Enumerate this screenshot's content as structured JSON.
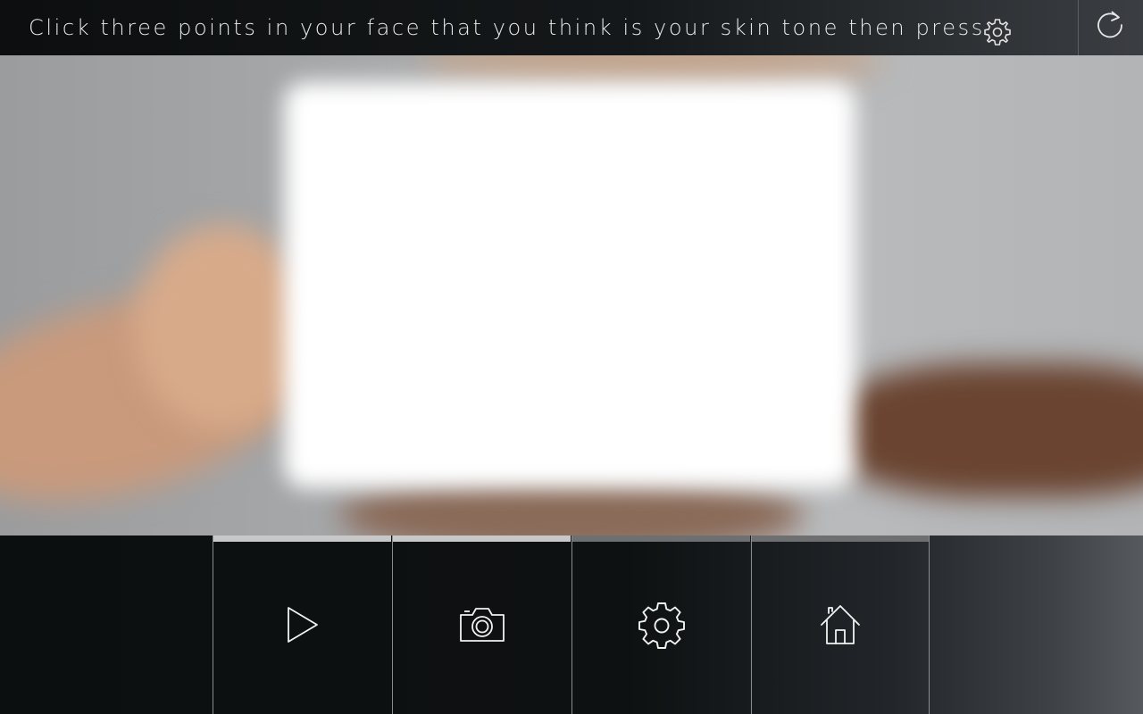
{
  "header": {
    "instruction": "Click three points in your face that you think is your skin tone then press",
    "inline_icon": "gear-icon",
    "refresh_icon": "refresh-icon"
  },
  "preview": {
    "description_icon": "camera-preview"
  },
  "toolbar": {
    "buttons": [
      {
        "icon": "play-icon",
        "strip_color": "#c8c8c8"
      },
      {
        "icon": "camera-icon",
        "strip_color": "#c8c8c8"
      },
      {
        "icon": "gear-icon",
        "strip_color": "#6e6f70"
      },
      {
        "icon": "home-icon",
        "strip_color": "#6e6f70"
      }
    ]
  },
  "colors": {
    "bar_dark": "#0c0e0f",
    "text": "#e9e9e9",
    "divider": "#8a8d90"
  }
}
